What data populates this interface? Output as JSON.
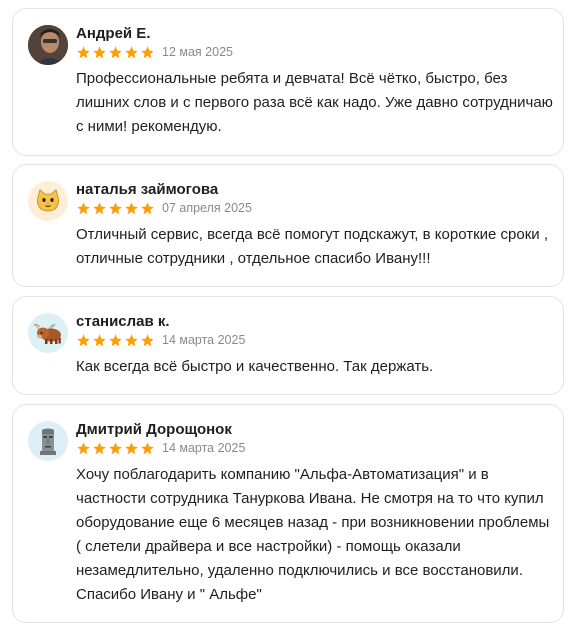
{
  "colors": {
    "star": "#fc9e06",
    "border": "#e3e3e3",
    "date": "#8a8a8a"
  },
  "reviews": [
    {
      "author": "Андрей Е.",
      "avatar_icon": "photo-avatar",
      "rating": 5,
      "date": "12 мая 2025",
      "text": "Профессиональные ребята и девчата! Всё чётко, быстро, без лишних слов и с первого раза всё как надо. Уже давно сотрудничаю с ними! рекомендую."
    },
    {
      "author": "наталья займогова",
      "avatar_icon": "cat-icon",
      "rating": 5,
      "date": "07 апреля 2025",
      "text": "Отличный сервис, всегда всё помогут подскажут, в короткие сроки , отличные сотрудники , отдельное спасибо Ивану!!!"
    },
    {
      "author": "станислав к.",
      "avatar_icon": "yak-icon",
      "rating": 5,
      "date": "14 марта 2025",
      "text": "Как всегда всё быстро и качественно. Так держать."
    },
    {
      "author": "Дмитрий Дорощонок",
      "avatar_icon": "moai-icon",
      "rating": 5,
      "date": "14 марта 2025",
      "text": "Хочу поблагодарить компанию \"Альфа-Автоматизация\" и в частности сотрудника Тануркова Ивана. Не смотря на то что купил оборудование еще 6 месяцев назад - при возникновении проблемы ( слетели драйвера и все настройки) - помощь оказали незамедлительно, удаленно подключились и все восстановили. Спасибо Ивану и \" Альфе\""
    }
  ]
}
